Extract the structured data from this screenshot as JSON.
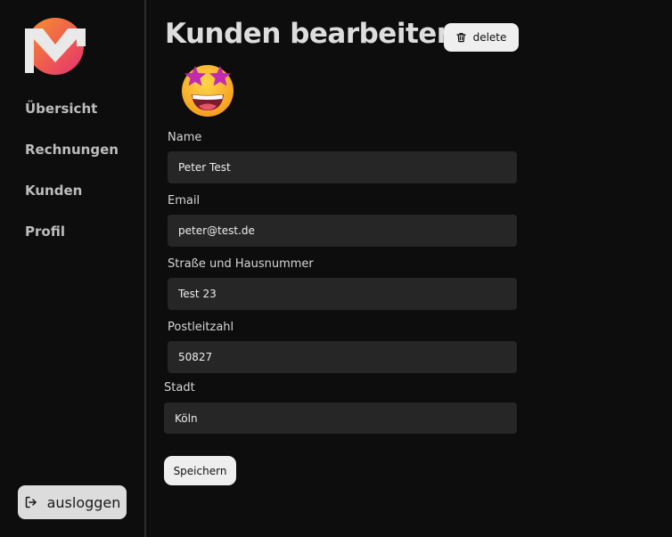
{
  "sidebar": {
    "logo": "app-logo",
    "items": [
      {
        "label": "Übersicht"
      },
      {
        "label": "Rechnungen"
      },
      {
        "label": "Kunden"
      },
      {
        "label": "Profil"
      }
    ],
    "logout_label": "ausloggen",
    "logout_icon": "logout-icon"
  },
  "header": {
    "title": "Kunden bearbeiten",
    "delete_label": "delete",
    "delete_icon": "trash-icon"
  },
  "avatar": {
    "emoji": "star-struck-emoji"
  },
  "form": {
    "name_label": "Name",
    "name_value": "Peter Test",
    "email_label": "Email",
    "email_value": "peter@test.de",
    "street_label": "Straße und Hausnummer",
    "street_value": "Test 23",
    "zip_label": "Postleitzahl",
    "zip_value": "50827",
    "city_label": "Stadt",
    "city_value": "Köln",
    "save_label": "Speichern"
  },
  "colors": {
    "background": "#0d0d0d",
    "input_background": "#262626",
    "logo_gradient_start": "#f57c2e",
    "logo_gradient_end": "#e8336d"
  }
}
